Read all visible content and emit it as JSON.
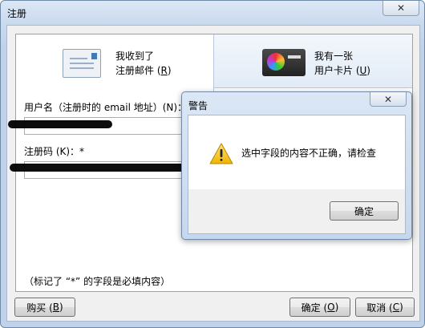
{
  "window": {
    "title": "注册",
    "close_glyph": "✕"
  },
  "tabs": [
    {
      "line1": "我收到了",
      "line2_prefix": "注册邮件 (",
      "line2_key": "R",
      "line2_suffix": ")"
    },
    {
      "line1": "我有一张",
      "line2_prefix": "用户卡片 (",
      "line2_key": "U",
      "line2_suffix": ")"
    }
  ],
  "form": {
    "username_label": "用户名（注册时的 email 地址）(N)：*",
    "username_value": "",
    "code_label": "注册码 (K)：*",
    "code_value": "",
    "required_note": "（标记了 “*” 的字段是必填内容）"
  },
  "buttons": {
    "buy_prefix": "购买 (",
    "buy_key": "B",
    "buy_suffix": ")",
    "ok_prefix": "确定 (",
    "ok_key": "O",
    "ok_suffix": ")",
    "cancel_prefix": "取消 (",
    "cancel_key": "C",
    "cancel_suffix": ")"
  },
  "alert": {
    "title": "警告",
    "close_glyph": "✕",
    "message": "选中字段的内容不正确，请检查",
    "ok_label": "确定",
    "icon": "warning-icon"
  }
}
